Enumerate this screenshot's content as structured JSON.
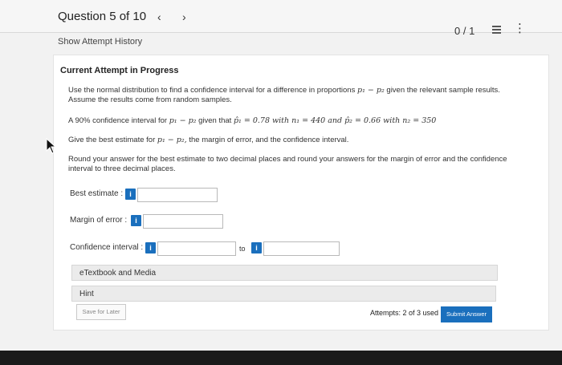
{
  "header": {
    "question_label": "Question 5 of 10",
    "prev_arrow": "‹",
    "next_arrow": "›",
    "score": "0 / 1",
    "menu_icon": "⋮"
  },
  "show_attempt_history": "Show Attempt History",
  "attempt": {
    "title": "Current Attempt in Progress",
    "intro_line1": "Use the normal distribution to find a confidence interval for a difference in proportions",
    "intro_p": "p₁ − p₂",
    "intro_line1_end": "given the relevant sample results.",
    "intro_line2": "Assume the results come from random samples.",
    "given_prefix": "A 90% confidence interval for",
    "given_p": "p₁ − p₂",
    "given_mid": "given that",
    "given_math": "p̂₁ = 0.78 with n₁ = 440 and p̂₂ = 0.66 with n₂ = 350",
    "best_prefix": "Give the best estimate for",
    "best_p": "p₁ − p₂,",
    "best_suffix": "the margin of error, and the confidence interval.",
    "round_line1": "Round your answer for the best estimate to two decimal places and round your answers for the margin of error and the confidence",
    "round_line2": "interval to three decimal places."
  },
  "fields": {
    "best_estimate_label": "Best estimate :",
    "margin_label": "Margin of error :",
    "ci_label": "Confidence interval :",
    "to_label": "to",
    "info_icon_text": "i"
  },
  "etextbook_label": "eTextbook and Media",
  "hint_label": "Hint",
  "save_label": "Save for Later",
  "attempts_text": "Attempts: 2 of 3 used",
  "submit_label": "Submit Answer",
  "icons": [
    "chevron-left-icon",
    "chevron-right-icon",
    "list-icon",
    "kebab-menu-icon",
    "info-icon",
    "mouse-cursor-icon"
  ],
  "colors": {
    "accent": "#1a6fbd",
    "background": "#f2f2f2",
    "panel": "#ffffff"
  }
}
